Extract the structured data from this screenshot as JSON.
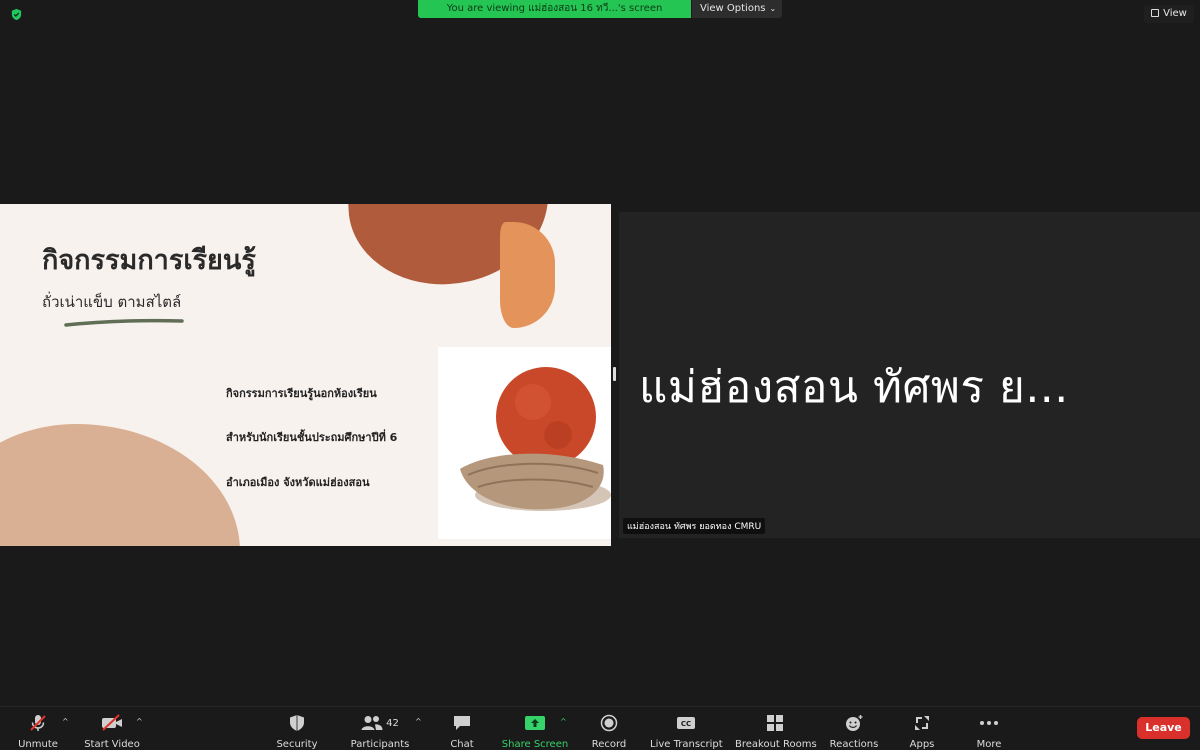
{
  "top": {
    "viewing_banner": "You are viewing แม่ฮ่องสอน 16 ทวี...'s screen",
    "view_options_label": "View Options",
    "view_label": "View"
  },
  "slide": {
    "title": "กิจกรรมการเรียนรู้",
    "subtitle": "ถั่วเน่าแข็บ ตามสไตล์",
    "bullets": [
      "กิจกรรมการเรียนรู้นอกห้องเรียน",
      "สำหรับนักเรียนชั้นประถมศึกษาปีที่ 6",
      "อำเภอเมือง จังหวัดแม่ฮ่องสอน"
    ]
  },
  "participant": {
    "display_name_big": "แม่ฮ่องสอน ทัศพร ย...",
    "name_tag": "แม่ฮ่องสอน ทัศพร  ยอดทอง  CMRU"
  },
  "toolbar": {
    "unmute": "Unmute",
    "start_video": "Start Video",
    "security": "Security",
    "participants": "Participants",
    "participants_count": "42",
    "chat": "Chat",
    "share_screen": "Share Screen",
    "record": "Record",
    "live_transcript": "Live Transcript",
    "breakout_rooms": "Breakout Rooms",
    "reactions": "Reactions",
    "apps": "Apps",
    "more": "More",
    "leave": "Leave",
    "cc_text": "CC"
  },
  "colors": {
    "share_green": "#36d26a",
    "banner_green": "#24c552",
    "leave_red": "#d9302b"
  }
}
